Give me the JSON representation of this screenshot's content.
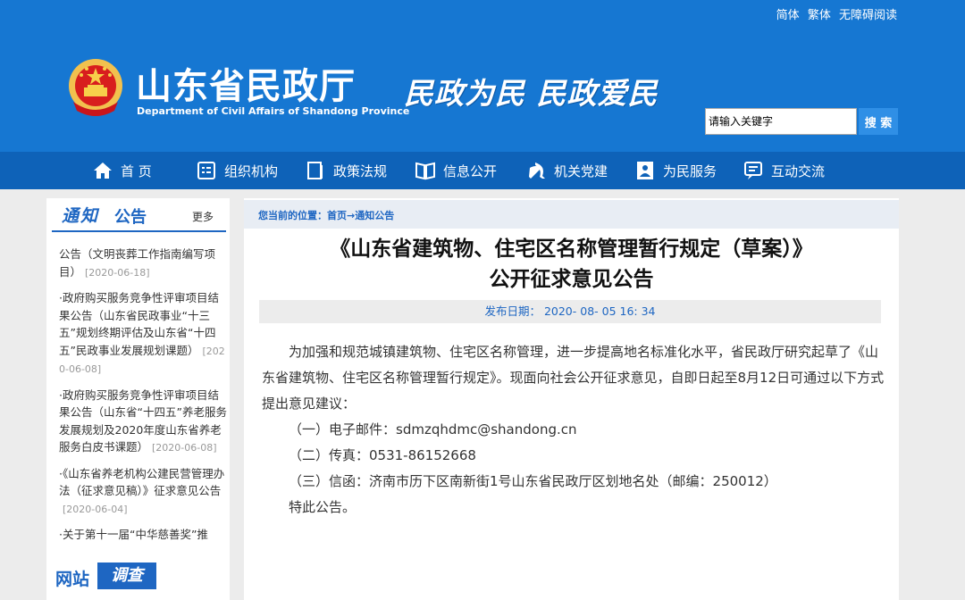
{
  "header": {
    "lang_links": [
      "简体",
      "繁体",
      "无障碍阅读"
    ],
    "title": "山东省民政厅",
    "subtitle": "Department of Civil Affairs of Shandong Province",
    "slogan": "民政为民  民政爱民",
    "search_placeholder": "请输入关键字",
    "search_button": "搜 索"
  },
  "nav": {
    "items": [
      {
        "label": "首 页",
        "icon": "home-icon"
      },
      {
        "label": "组织机构",
        "icon": "org-icon"
      },
      {
        "label": "政策法规",
        "icon": "doc-icon"
      },
      {
        "label": "信息公开",
        "icon": "book-icon"
      },
      {
        "label": "机关党建",
        "icon": "party-icon"
      },
      {
        "label": "为民服务",
        "icon": "service-icon"
      },
      {
        "label": "互动交流",
        "icon": "chat-icon"
      }
    ]
  },
  "sidebar": {
    "notice_title_a": "通知",
    "notice_title_b": "公告",
    "more": "更多",
    "items": [
      {
        "text": "公告（文明丧葬工作指南编写项目）",
        "date": "[2020-06-18]"
      },
      {
        "text": "·政府购买服务竞争性评审项目结果公告（山东省民政事业“十三五”规划终期评估及山东省“十四五”民政事业发展规划课题）",
        "date": "[2020-06-08]"
      },
      {
        "text": "·政府购买服务竞争性评审项目结果公告（山东省“十四五”养老服务发展规划及2020年度山东省养老服务白皮书课题）",
        "date": "[2020-06-08]"
      },
      {
        "text": "·《山东省养老机构公建民营管理办法（征求意见稿）》征求意见公告",
        "date": "[2020-06-04]"
      },
      {
        "text": "·关于第十一届“中华慈善奖”推",
        "date": ""
      }
    ],
    "survey_a": "网站",
    "survey_b": "调查"
  },
  "breadcrumb": {
    "prefix": "您当前的位置：",
    "home": "首页",
    "arrow": "→",
    "current": "通知公告"
  },
  "article": {
    "title_line1": "《山东省建筑物、住宅区名称管理暂行规定（草案）》",
    "title_line2": "公开征求意见公告",
    "pub_date": "发布日期： 2020- 08- 05 16: 34",
    "para1": "为加强和规范城镇建筑物、住宅区名称管理，进一步提高地名标准化水平，省民政厅研究起草了《山东省建筑物、住宅区名称管理暂行规定》。现面向社会公开征求意见，自即日起至8月12日可通过以下方式提出意见建议：",
    "items": [
      "（一）电子邮件：sdmzqhdmc@shandong.cn",
      "（二）传真：0531-86152668",
      "（三）信函：济南市历下区南新街1号山东省民政厅区划地名处（邮编：250012）"
    ],
    "closing": "特此公告。"
  },
  "colors": {
    "header_blue": "#1677d2",
    "nav_blue": "#0e62b8",
    "link_blue": "#1e66c2"
  }
}
